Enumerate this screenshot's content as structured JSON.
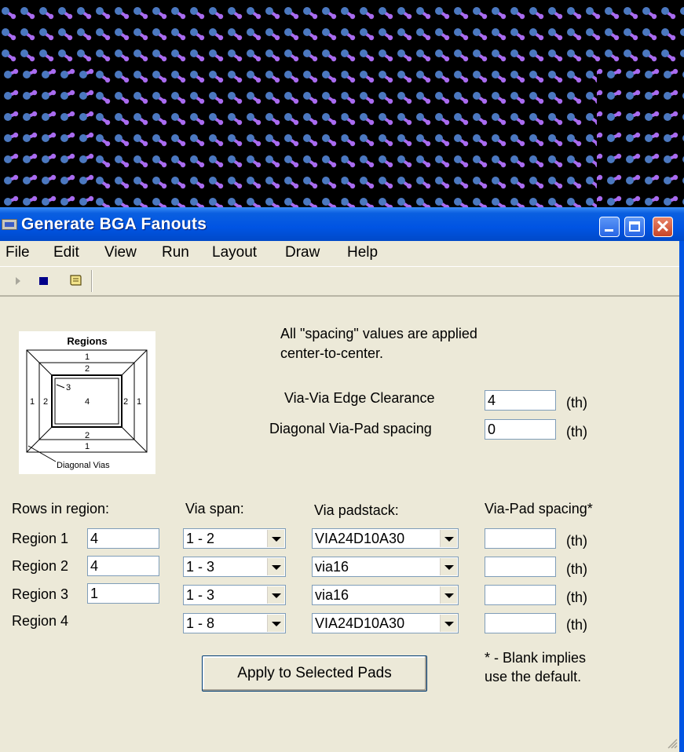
{
  "window": {
    "title": "Generate BGA Fanouts"
  },
  "menu": [
    "File",
    "Edit",
    "View",
    "Run",
    "Layout",
    "Draw",
    "Help"
  ],
  "toolbar": {
    "icons": [
      "run-icon",
      "stop-icon",
      "script-icon"
    ]
  },
  "regions_diagram": {
    "title": "Regions",
    "labels": [
      "1",
      "2",
      "3",
      "4",
      "1",
      "2",
      "2",
      "1",
      "2",
      "1"
    ],
    "caption": "Diagonal Vias"
  },
  "note": {
    "line1": "All \"spacing\" values are applied",
    "line2": "center-to-center."
  },
  "clearance": {
    "via_via_label": "Via-Via Edge Clearance",
    "via_via_value": "4",
    "diagonal_label": "Diagonal Via-Pad spacing",
    "diagonal_value": "0",
    "unit": "(th)"
  },
  "table": {
    "headers": {
      "rows": "Rows in region:",
      "span": "Via span:",
      "padstack": "Via padstack:",
      "spacing": "Via-Pad spacing*"
    },
    "rows": [
      {
        "label": "Region 1",
        "rows_value": "4",
        "span": "1 - 2",
        "padstack": "VIA24D10A30",
        "spacing": "",
        "unit": "(th)"
      },
      {
        "label": "Region 2",
        "rows_value": "4",
        "span": "1 - 3",
        "padstack": "via16",
        "spacing": "",
        "unit": "(th)"
      },
      {
        "label": "Region 3",
        "rows_value": "1",
        "span": "1 - 3",
        "padstack": "via16",
        "spacing": "",
        "unit": "(th)"
      },
      {
        "label": "Region 4",
        "span": "1 - 8",
        "padstack": "VIA24D10A30",
        "spacing": "",
        "unit": "(th)"
      }
    ]
  },
  "apply_button": "Apply to Selected Pads",
  "footnote": {
    "line1": "* - Blank implies",
    "line2": "use the default."
  },
  "colors": {
    "titlebar": "#0054e3",
    "dialog": "#ece9d8",
    "pad": "#4b78c0",
    "trace": "#a96bf0"
  }
}
